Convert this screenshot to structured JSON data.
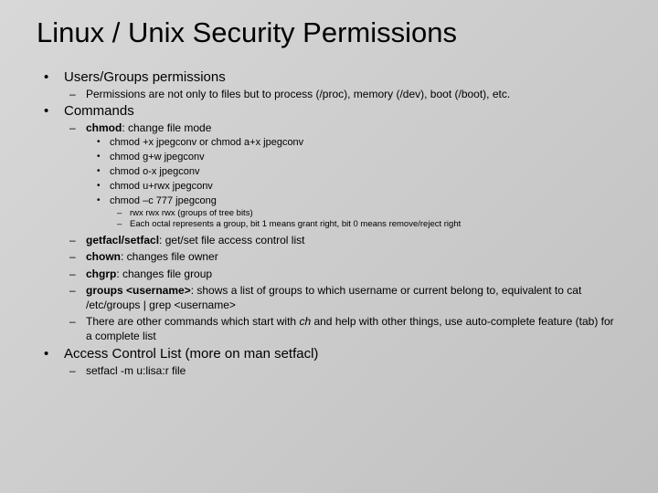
{
  "title": "Linux / Unix Security Permissions",
  "s1": {
    "h": "Users/Groups permissions",
    "a": "Permissions are not only to files but to process (/proc), memory (/dev), boot (/boot), etc."
  },
  "s2": {
    "h": "Commands",
    "chmod": {
      "b": "chmod",
      "t": ": change file mode"
    },
    "ex": {
      "a": "chmod +x jpegconv or chmod a+x jpegconv",
      "b": "chmod g+w jpegconv",
      "c": "chmod o-x jpegconv",
      "d": "chmod u+rwx jpegconv",
      "e": "chmod –c 777 jpegcong"
    },
    "oct": {
      "a": "rwx rwx rwx (groups of tree bits)",
      "b": "Each octal represents a group, bit 1 means grant right, bit 0 means remove/reject right"
    },
    "facl": {
      "b": "getfacl/setfacl",
      "t": ": get/set file access control list"
    },
    "chown": {
      "b": "chown",
      "t": ": changes file owner"
    },
    "chgrp": {
      "b": "chgrp",
      "t": ": changes file group"
    },
    "groups": {
      "b": "groups <username>",
      "t": ": shows a list of groups to which username or current belong to, equivalent to cat /etc/groups | grep <username>"
    },
    "more": {
      "a": "There are other commands which start with ",
      "i": "ch",
      "b": " and help with other things, use auto-complete feature (tab) for a complete list"
    }
  },
  "s3": {
    "h": "Access Control List (more on man setfacl)",
    "a": "setfacl -m u:lisa:r file"
  }
}
